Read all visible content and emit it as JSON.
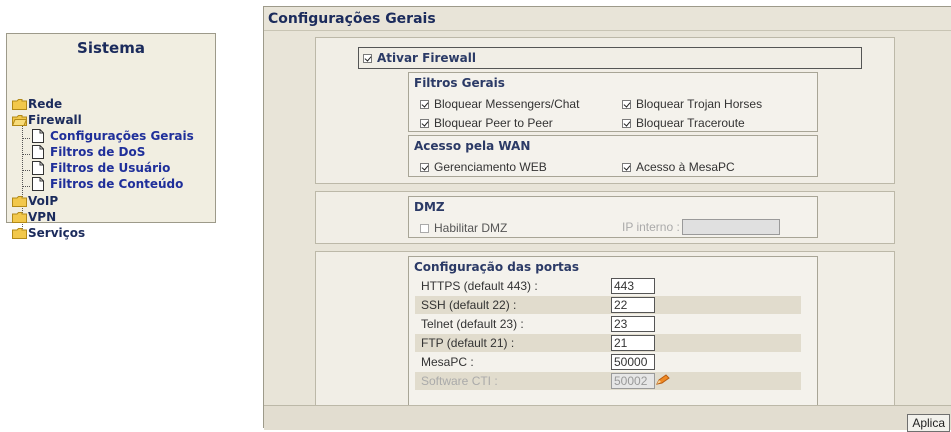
{
  "sidebar": {
    "title": "Sistema",
    "items": [
      {
        "label": "Rede"
      },
      {
        "label": "Firewall"
      },
      {
        "label": "Configurações Gerais"
      },
      {
        "label": "Filtros de DoS"
      },
      {
        "label": "Filtros de Usuário"
      },
      {
        "label": "Filtros de Conteúdo"
      },
      {
        "label": "VoIP"
      },
      {
        "label": "VPN"
      },
      {
        "label": "Serviços"
      }
    ]
  },
  "main": {
    "title": "Configurações Gerais",
    "firewall": {
      "enable_label": "Ativar Firewall",
      "enabled": true,
      "filtros_gerais": {
        "legend": "Filtros Gerais",
        "options": [
          {
            "label": "Bloquear Messengers/Chat",
            "checked": true
          },
          {
            "label": "Bloquear Trojan Horses",
            "checked": true
          },
          {
            "label": "Bloquear Peer to Peer",
            "checked": true
          },
          {
            "label": "Bloquear Traceroute",
            "checked": true
          }
        ]
      },
      "acesso_wan": {
        "legend": "Acesso pela WAN",
        "options": [
          {
            "label": "Gerenciamento WEB",
            "checked": true
          },
          {
            "label": "Acesso à MesaPC",
            "checked": true
          }
        ]
      }
    },
    "dmz": {
      "legend": "DMZ",
      "enable_label": "Habilitar DMZ",
      "enabled": false,
      "ip_label": "IP interno :",
      "ip_value": ""
    },
    "ports": {
      "legend": "Configuração das portas",
      "rows": [
        {
          "label": "HTTPS (default 443) :",
          "value": "443"
        },
        {
          "label": "SSH (default 22) :",
          "value": "22"
        },
        {
          "label": "Telnet (default 23) :",
          "value": "23"
        },
        {
          "label": "FTP (default 21) :",
          "value": "21"
        },
        {
          "label": "MesaPC :",
          "value": "50000"
        },
        {
          "label": "Software CTI :",
          "value": "50002"
        }
      ]
    },
    "apply_label": "Aplica"
  },
  "colors": {
    "accent": "#1b2b5c",
    "link": "#1f2f9a",
    "folder": "#f2c84b",
    "panel": "#e8e4d8"
  }
}
